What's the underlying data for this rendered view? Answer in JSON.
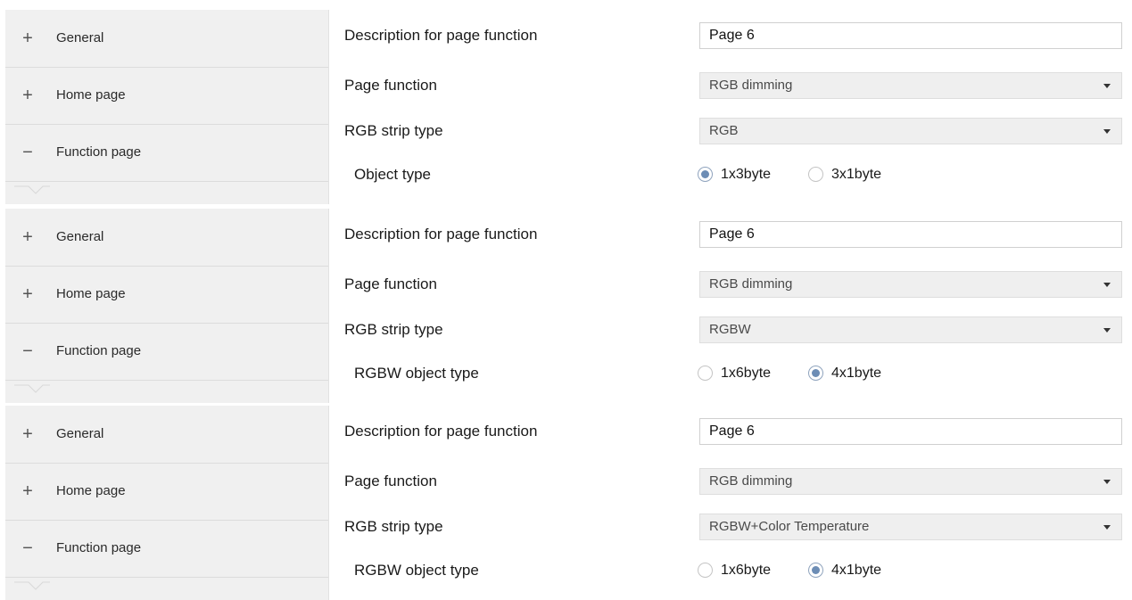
{
  "panels": [
    {
      "sidebar": {
        "items": [
          {
            "sign": "+",
            "label": "General"
          },
          {
            "sign": "+",
            "label": "Home page"
          },
          {
            "sign": "−",
            "label": "Function page"
          }
        ]
      },
      "rows": {
        "description_label": "Description for page function",
        "description_value": "Page 6",
        "page_function_label": "Page function",
        "page_function_value": "RGB dimming",
        "strip_type_label": "RGB strip type",
        "strip_type_value": "RGB",
        "object_type_label": "Object type",
        "options": [
          {
            "label": "1x3byte",
            "selected": true
          },
          {
            "label": "3x1byte",
            "selected": false
          }
        ]
      }
    },
    {
      "sidebar": {
        "items": [
          {
            "sign": "+",
            "label": "General"
          },
          {
            "sign": "+",
            "label": "Home page"
          },
          {
            "sign": "−",
            "label": "Function page"
          }
        ]
      },
      "rows": {
        "description_label": "Description for page function",
        "description_value": "Page 6",
        "page_function_label": "Page function",
        "page_function_value": "RGB dimming",
        "strip_type_label": "RGB strip type",
        "strip_type_value": "RGBW",
        "object_type_label": "RGBW object type",
        "options": [
          {
            "label": "1x6byte",
            "selected": false
          },
          {
            "label": "4x1byte",
            "selected": true
          }
        ]
      }
    },
    {
      "sidebar": {
        "items": [
          {
            "sign": "+",
            "label": "General"
          },
          {
            "sign": "+",
            "label": "Home page"
          },
          {
            "sign": "−",
            "label": "Function page"
          }
        ]
      },
      "rows": {
        "description_label": "Description for page function",
        "description_value": "Page 6",
        "page_function_label": "Page function",
        "page_function_value": "RGB dimming",
        "strip_type_label": "RGB strip type",
        "strip_type_value": "RGBW+Color Temperature",
        "object_type_label": "RGBW object type",
        "options": [
          {
            "label": "1x6byte",
            "selected": false
          },
          {
            "label": "4x1byte",
            "selected": true
          }
        ]
      }
    }
  ]
}
